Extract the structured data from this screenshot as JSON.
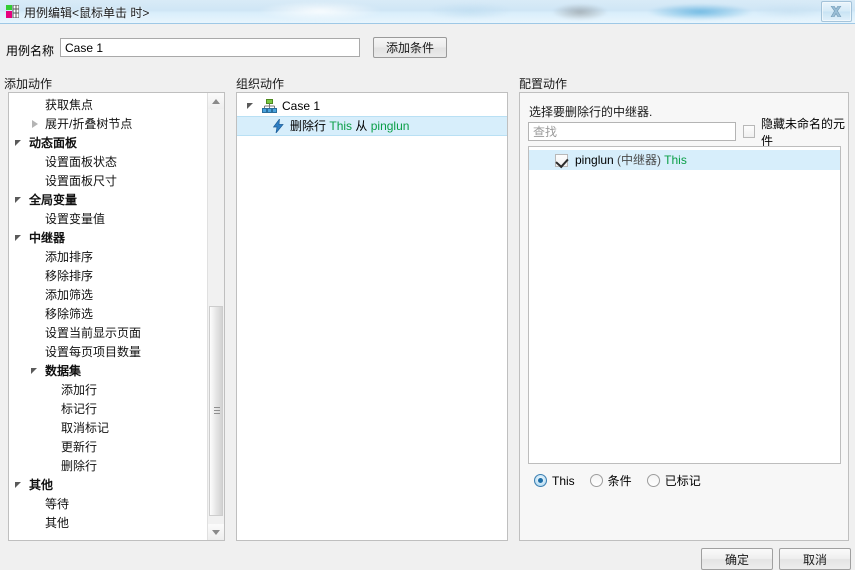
{
  "window": {
    "title": "用例编辑<鼠标单击 时>",
    "close_label": "×",
    "app_icon": "grid-icon"
  },
  "case_row": {
    "name_label": "用例名称",
    "name_value": "Case 1",
    "name_placeholder": "",
    "add_condition_label": "添加条件"
  },
  "sections": {
    "add_action": "添加动作",
    "organize_action": "组织动作",
    "configure_action": "配置动作"
  },
  "action_tree": [
    {
      "label": "获取焦点",
      "indent": 2,
      "group": false,
      "arrow": "none"
    },
    {
      "label": "展开/折叠树节点",
      "indent": 2,
      "group": false,
      "arrow": "closed"
    },
    {
      "label": "动态面板",
      "indent": 1,
      "group": true,
      "arrow": "open"
    },
    {
      "label": "设置面板状态",
      "indent": 2,
      "group": false,
      "arrow": "none"
    },
    {
      "label": "设置面板尺寸",
      "indent": 2,
      "group": false,
      "arrow": "none"
    },
    {
      "label": "全局变量",
      "indent": 1,
      "group": true,
      "arrow": "open"
    },
    {
      "label": "设置变量值",
      "indent": 2,
      "group": false,
      "arrow": "none"
    },
    {
      "label": "中继器",
      "indent": 1,
      "group": true,
      "arrow": "open"
    },
    {
      "label": "添加排序",
      "indent": 2,
      "group": false,
      "arrow": "none"
    },
    {
      "label": "移除排序",
      "indent": 2,
      "group": false,
      "arrow": "none"
    },
    {
      "label": "添加筛选",
      "indent": 2,
      "group": false,
      "arrow": "none"
    },
    {
      "label": "移除筛选",
      "indent": 2,
      "group": false,
      "arrow": "none"
    },
    {
      "label": "设置当前显示页面",
      "indent": 2,
      "group": false,
      "arrow": "none"
    },
    {
      "label": "设置每页项目数量",
      "indent": 2,
      "group": false,
      "arrow": "none"
    },
    {
      "label": "数据集",
      "indent": 2,
      "group": true,
      "arrow": "open"
    },
    {
      "label": "添加行",
      "indent": 3,
      "group": false,
      "arrow": "none"
    },
    {
      "label": "标记行",
      "indent": 3,
      "group": false,
      "arrow": "none"
    },
    {
      "label": "取消标记",
      "indent": 3,
      "group": false,
      "arrow": "none"
    },
    {
      "label": "更新行",
      "indent": 3,
      "group": false,
      "arrow": "none"
    },
    {
      "label": "删除行",
      "indent": 3,
      "group": false,
      "arrow": "none"
    },
    {
      "label": "其他",
      "indent": 1,
      "group": true,
      "arrow": "open"
    },
    {
      "label": "等待",
      "indent": 2,
      "group": false,
      "arrow": "none"
    },
    {
      "label": "其他",
      "indent": 2,
      "group": false,
      "arrow": "none"
    }
  ],
  "organize_tree": {
    "case_label": "Case 1",
    "case_icon": "sitemap-icon",
    "action_icon": "lightning-icon",
    "action_prefix": "删除行",
    "action_target": "This",
    "action_connector": "从",
    "action_source": "pinglun"
  },
  "configure": {
    "hint": "选择要删除行的中继器.",
    "search_placeholder": "查找",
    "search_value": "",
    "hide_unnamed_label": "隐藏未命名的元件",
    "hide_unnamed_checked": false,
    "list_items": [
      {
        "checked": true,
        "name": "pinglun",
        "type": "(中继器)",
        "scope": "This",
        "selected": true
      }
    ],
    "radios": [
      {
        "label": "This",
        "selected": true
      },
      {
        "label": "条件",
        "selected": false
      },
      {
        "label": "已标记",
        "selected": false
      }
    ]
  },
  "footer": {
    "ok_label": "确定",
    "cancel_label": "取消"
  },
  "colors": {
    "selection_blue": "#d7eefb",
    "green_text": "#0a9e46",
    "titlebar_blue": "#cfe6f6"
  }
}
